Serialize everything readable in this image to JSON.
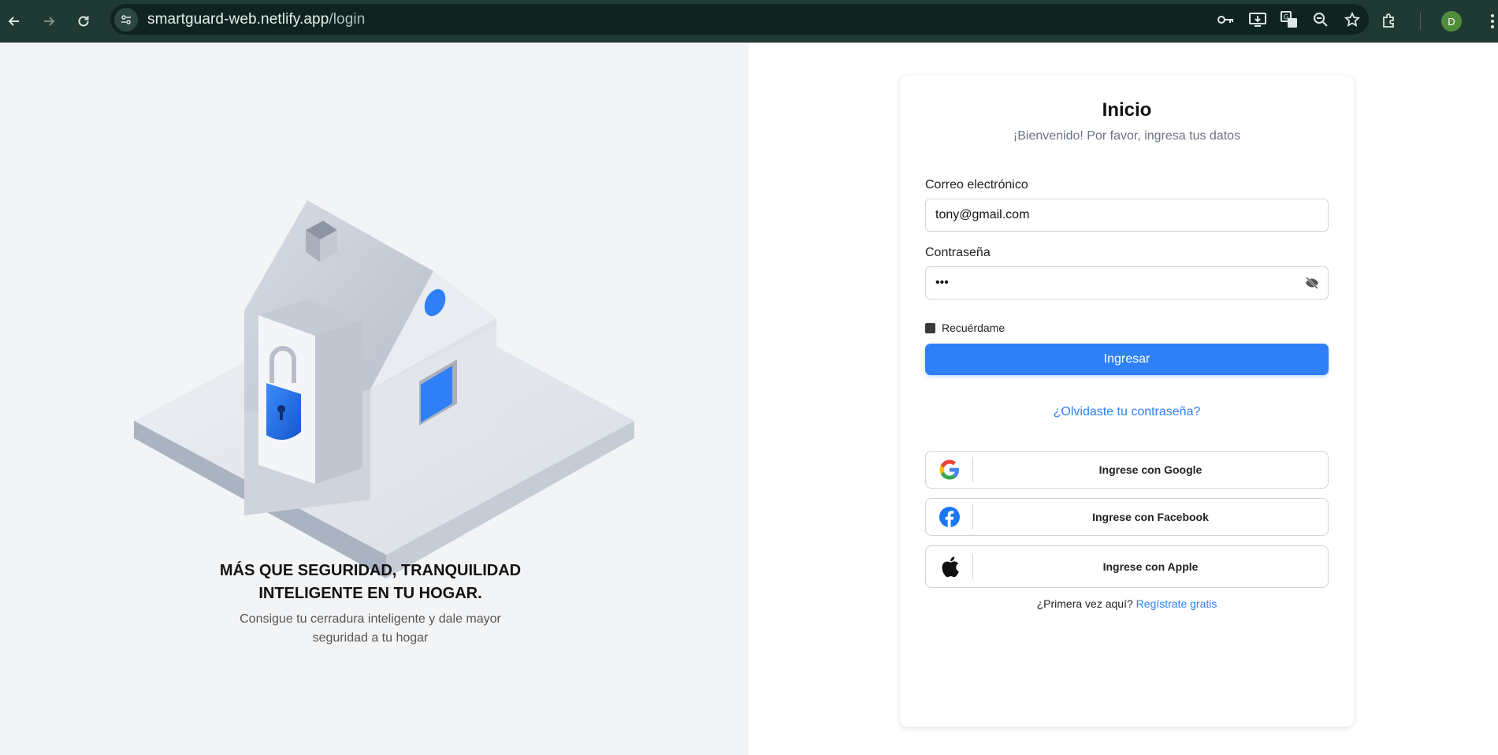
{
  "browser": {
    "url_host": "smartguard-web.netlify.app",
    "url_path": "/login",
    "profile_initial": "D"
  },
  "hero": {
    "tagline_line1": "MÁS QUE SEGURIDAD, TRANQUILIDAD",
    "tagline_line2": "INTELIGENTE EN TU HOGAR.",
    "subtitle_line1": "Consigue tu cerradura inteligente y dale mayor",
    "subtitle_line2": "seguridad a tu hogar"
  },
  "login": {
    "title": "Inicio",
    "subtitle": "¡Bienvenido! Por favor, ingresa tus datos",
    "email_label": "Correo electrónico",
    "email_value": "tony@gmail.com",
    "password_label": "Contraseña",
    "password_value": "•••",
    "remember_label": "Recuérdame",
    "submit_label": "Ingresar",
    "forgot_label": "¿Olvidaste tu contraseña?",
    "social": [
      {
        "label": "Ingrese con Google",
        "icon": "google-icon"
      },
      {
        "label": "Ingrese con Facebook",
        "icon": "facebook-icon"
      },
      {
        "label": "Ingrese con Apple",
        "icon": "apple-icon"
      }
    ],
    "signup_prompt": "¿Primera vez aquí?",
    "signup_link": "Regístrate gratis"
  },
  "colors": {
    "accent": "#2f80f7",
    "chrome": "#1f3a33",
    "left_panel": "#f3f4f6"
  }
}
